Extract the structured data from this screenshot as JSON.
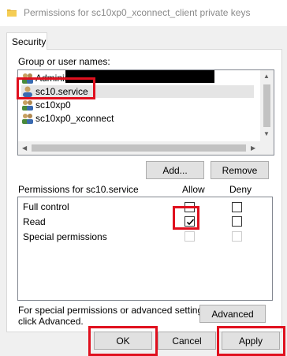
{
  "window": {
    "title": "Permissions for sc10xp0_xconnect_client private keys",
    "icon": "folder-icon"
  },
  "tabs": [
    {
      "label": "Security"
    }
  ],
  "group_list": {
    "label": "Group or user names:",
    "items": [
      {
        "name": "Administrators",
        "icon": "group-icon",
        "redacted": true
      },
      {
        "name": "sc10.service",
        "icon": "user-icon",
        "selected": true
      },
      {
        "name": "sc10xp0",
        "icon": "group-icon"
      },
      {
        "name": "sc10xp0_xconnect",
        "icon": "group-icon"
      }
    ]
  },
  "buttons": {
    "add": "Add...",
    "remove": "Remove",
    "advanced": "Advanced",
    "ok": "OK",
    "cancel": "Cancel",
    "apply": "Apply"
  },
  "permissions": {
    "header": "Permissions for sc10.service",
    "allow_header": "Allow",
    "deny_header": "Deny",
    "rows": [
      {
        "name": "Full control",
        "allow": false,
        "deny": false,
        "disabled": false
      },
      {
        "name": "Read",
        "allow": true,
        "deny": false,
        "disabled": false
      },
      {
        "name": "Special permissions",
        "allow": false,
        "deny": false,
        "disabled": true
      }
    ]
  },
  "advanced_note": {
    "line1": "For special permissions or advanced settings,",
    "line2": "click Advanced."
  },
  "highlight_color": "#e0101e"
}
